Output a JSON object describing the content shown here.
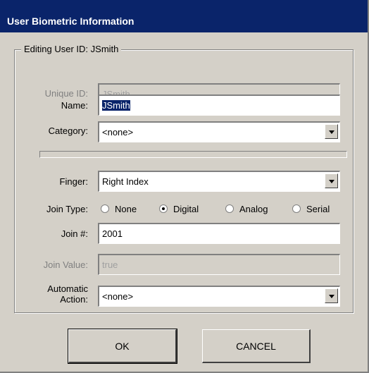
{
  "window": {
    "title": "User Biometric Information"
  },
  "group": {
    "title": "Editing User ID: JSmith"
  },
  "fields": {
    "unique_id": {
      "label": "Unique ID:",
      "value": "JSmith"
    },
    "name": {
      "label": "Name:",
      "value": "JSmith"
    },
    "category": {
      "label": "Category:",
      "value": "<none>"
    },
    "finger": {
      "label": "Finger:",
      "value": "Right Index"
    },
    "join_type": {
      "label": "Join Type:",
      "options": [
        "None",
        "Digital",
        "Analog",
        "Serial"
      ],
      "selected": "Digital"
    },
    "join_num": {
      "label": "Join #:",
      "value": "2001"
    },
    "join_value": {
      "label": "Join Value:",
      "value": "true"
    },
    "automatic_action": {
      "label_line1": "Automatic",
      "label_line2": "Action:",
      "value": "<none>"
    }
  },
  "buttons": {
    "ok": "OK",
    "cancel": "CANCEL"
  },
  "icons": {
    "dropdown": "chevron-down-icon"
  },
  "colors": {
    "titlebar": "#0a246a",
    "face": "#d4d0c8",
    "selection": "#0a246a"
  }
}
